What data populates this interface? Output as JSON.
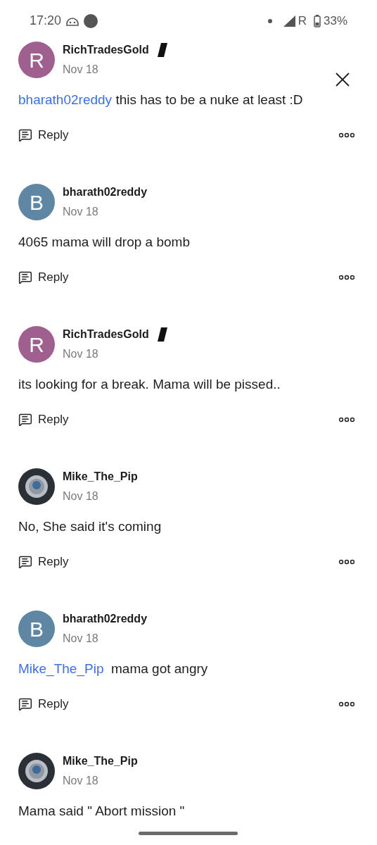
{
  "status_bar": {
    "time": "17:20",
    "network": "R",
    "battery": "33%"
  },
  "comments": [
    {
      "author": "RichTradesGold",
      "badge": true,
      "avatar": {
        "kind": "letter",
        "letter": "R",
        "color": "#a0608f"
      },
      "date": "Nov 18",
      "mention": "bharath02reddy",
      "text": "this has to be a nuke at least :D",
      "reply": "Reply"
    },
    {
      "author": "bharath02reddy",
      "badge": false,
      "avatar": {
        "kind": "letter",
        "letter": "B",
        "color": "#5f87a3"
      },
      "date": "Nov 18",
      "text": "4065 mama will drop a bomb",
      "reply": "Reply"
    },
    {
      "author": "RichTradesGold",
      "badge": true,
      "avatar": {
        "kind": "letter",
        "letter": "R",
        "color": "#a0608f"
      },
      "date": "Nov 18",
      "text": "its looking for a break. Mama will be pissed..",
      "reply": "Reply"
    },
    {
      "author": "Mike_The_Pip",
      "badge": false,
      "avatar": {
        "kind": "image"
      },
      "date": "Nov 18",
      "text": "No, She said it's coming",
      "reply": "Reply"
    },
    {
      "author": "bharath02reddy",
      "badge": false,
      "avatar": {
        "kind": "letter",
        "letter": "B",
        "color": "#5f87a3"
      },
      "date": "Nov 18",
      "mention": "Mike_The_Pip",
      "text": " mama got angry",
      "reply": "Reply"
    },
    {
      "author": "Mike_The_Pip",
      "badge": false,
      "avatar": {
        "kind": "image"
      },
      "date": "Nov 18",
      "text": "Mama said \" Abort mission \""
    }
  ]
}
